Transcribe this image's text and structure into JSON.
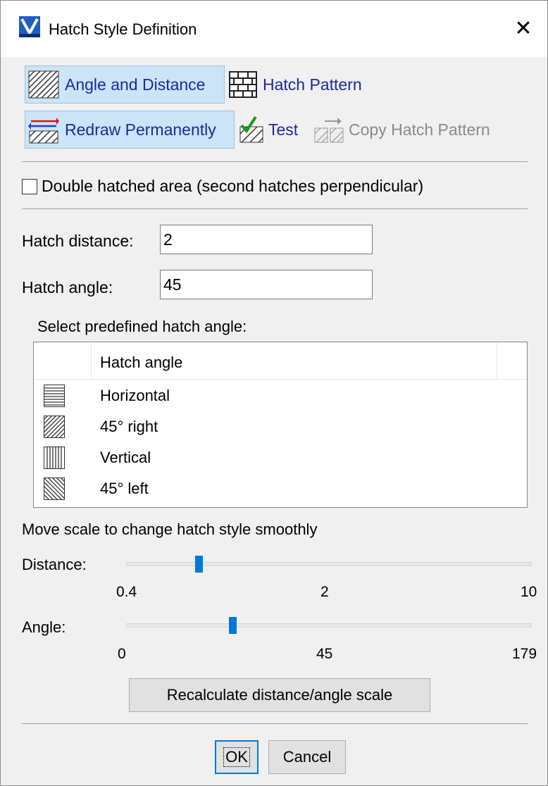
{
  "window": {
    "title": "Hatch Style Definition",
    "close_glyph": "✕"
  },
  "toolbar": {
    "angle_distance": "Angle and Distance",
    "hatch_pattern": "Hatch Pattern",
    "redraw_permanently": "Redraw Permanently",
    "test": "Test",
    "copy_hatch_pattern": "Copy Hatch Pattern"
  },
  "double_hatched": {
    "label": "Double hatched area (second hatches perpendicular)",
    "checked": false
  },
  "fields": {
    "distance_label": "Hatch distance:",
    "distance_value": "2",
    "angle_label": "Hatch angle:",
    "angle_value": "45"
  },
  "predefined": {
    "label": "Select predefined hatch angle:",
    "column": "Hatch angle",
    "rows": [
      {
        "icon": "horizontal-hatch-icon",
        "label": "Horizontal"
      },
      {
        "icon": "right-45-hatch-icon",
        "label": "45° right"
      },
      {
        "icon": "vertical-hatch-icon",
        "label": "Vertical"
      },
      {
        "icon": "left-45-hatch-icon",
        "label": "45° left"
      }
    ]
  },
  "scale": {
    "caption": "Move scale to change hatch style smoothly",
    "distance": {
      "label": "Distance:",
      "min": "0.4",
      "mid": "2",
      "max": "10",
      "value": 0.17
    },
    "angle": {
      "label": "Angle:",
      "min": "0",
      "mid": "45",
      "max": "179",
      "value": 0.255
    },
    "recalculate": "Recalculate distance/angle scale"
  },
  "buttons": {
    "ok": "OK",
    "cancel": "Cancel"
  },
  "colors": {
    "accent": "#0078d7",
    "selected_bg": "#cce4f7",
    "link_text": "#1a2a9e"
  }
}
